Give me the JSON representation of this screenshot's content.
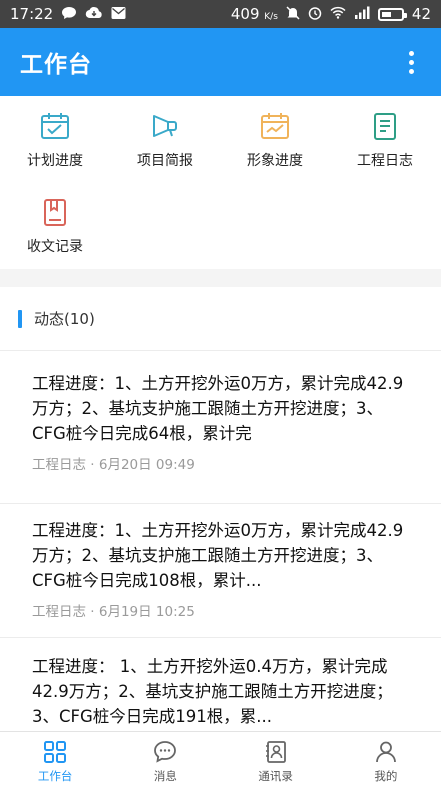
{
  "status_bar": {
    "time": "17:22",
    "speed": "409",
    "speed_unit": "K/s",
    "battery": "42"
  },
  "app_bar": {
    "title": "工作台"
  },
  "grid": {
    "items": [
      {
        "label": "计划进度",
        "icon": "calendar-check-icon"
      },
      {
        "label": "项目简报",
        "icon": "megaphone-icon"
      },
      {
        "label": "形象进度",
        "icon": "calendar-progress-icon"
      },
      {
        "label": "工程日志",
        "icon": "document-log-icon"
      },
      {
        "label": "收文记录",
        "icon": "book-icon"
      }
    ]
  },
  "feed": {
    "header": "动态(10)",
    "cards": [
      {
        "body": "工程进度：1、土方开挖外运0万方，累计完成42.9万方；2、基坑支护施工跟随土方开挖进度；3、CFG桩今日完成64根，累计完",
        "meta": "工程日志 · 6月20日 09:49"
      },
      {
        "body": "工程进度：1、土方开挖外运0万方，累计完成42.9万方；2、基坑支护施工跟随土方开挖进度；3、CFG桩今日完成108根，累计...",
        "meta": "工程日志 · 6月19日 10:25"
      },
      {
        "body": "工程进度： 1、土方开挖外运0.4万方，累计完成42.9万方；2、基坑支护施工跟随土方开挖进度；3、CFG桩今日完成191根，累...",
        "meta": ""
      }
    ]
  },
  "bottom_nav": {
    "items": [
      {
        "label": "工作台",
        "icon": "grid-icon",
        "active": true
      },
      {
        "label": "消息",
        "icon": "chat-icon",
        "active": false
      },
      {
        "label": "通讯录",
        "icon": "contacts-icon",
        "active": false
      },
      {
        "label": "我的",
        "icon": "person-icon",
        "active": false
      }
    ]
  },
  "colors": {
    "primary": "#2196f3",
    "icon_teal": "#3aa9c9",
    "icon_orange": "#f0b35a",
    "icon_green": "#2e9e86",
    "icon_red": "#d9655a"
  }
}
